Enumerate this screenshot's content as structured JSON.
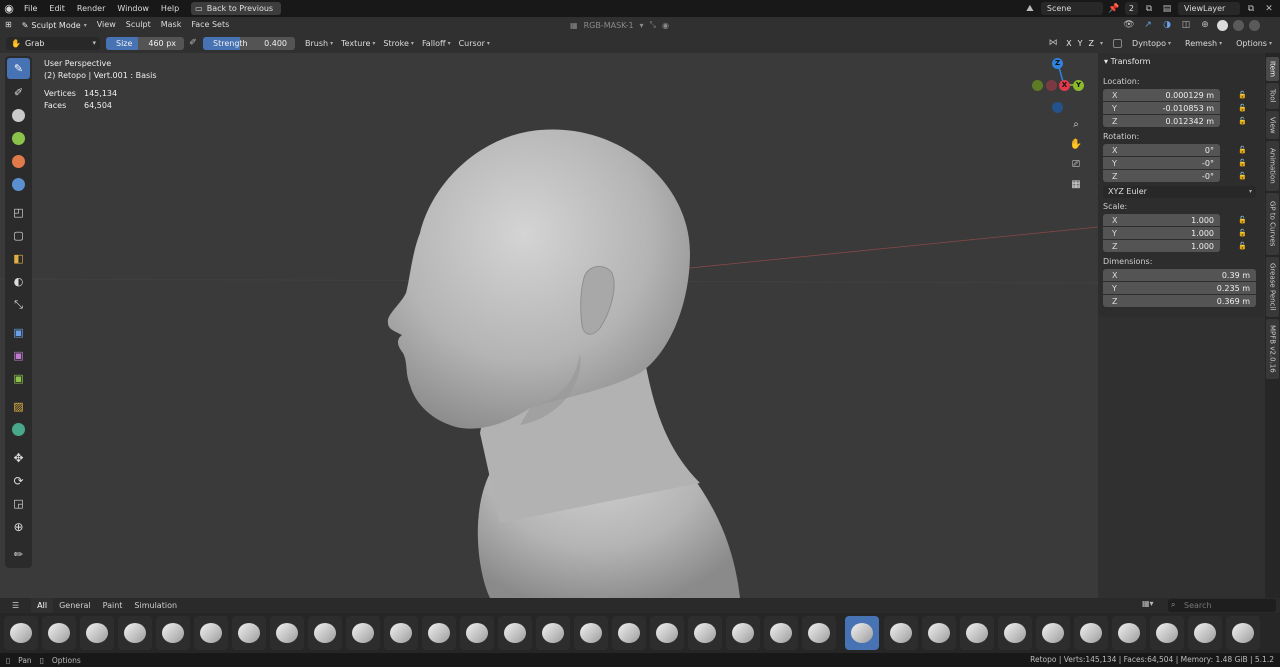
{
  "topbar": {
    "menus": [
      "File",
      "Edit",
      "Render",
      "Window",
      "Help"
    ],
    "back_button": "Back to Previous",
    "scene_label": "Scene",
    "scene_users": "2",
    "view_layer": "ViewLayer"
  },
  "header": {
    "mode": "Sculpt Mode",
    "menus": [
      "View",
      "Sculpt",
      "Mask",
      "Face Sets"
    ],
    "attribute": "RGB-MASK-1"
  },
  "toolsettings": {
    "brush": "Grab",
    "size_label": "Size",
    "size_value": "460 px",
    "strength_label": "Strength",
    "strength_value": "0.400",
    "strength_fraction": 0.4,
    "dropdowns": [
      "Brush",
      "Texture",
      "Stroke",
      "Falloff",
      "Cursor"
    ],
    "axes": [
      "X",
      "Y",
      "Z"
    ],
    "dyntopo": "Dyntopo",
    "remesh": "Remesh",
    "options": "Options"
  },
  "viewport": {
    "perspective": "User Perspective",
    "object": "(2) Retopo | Vert.001 : Basis",
    "stats": [
      {
        "label": "Vertices",
        "value": "145,134"
      },
      {
        "label": "Faces",
        "value": "64,504"
      }
    ],
    "gizmo": {
      "x": "X",
      "y": "Y",
      "z": "Z"
    }
  },
  "npanel": {
    "title": "Transform",
    "location_label": "Location:",
    "location": [
      {
        "axis": "X",
        "value": "0.000129 m"
      },
      {
        "axis": "Y",
        "value": "-0.010853 m"
      },
      {
        "axis": "Z",
        "value": "0.012342 m"
      }
    ],
    "rotation_label": "Rotation:",
    "rotation": [
      {
        "axis": "X",
        "value": "0°"
      },
      {
        "axis": "Y",
        "value": "-0°"
      },
      {
        "axis": "Z",
        "value": "-0°"
      }
    ],
    "rotation_mode": "XYZ Euler",
    "scale_label": "Scale:",
    "scale": [
      {
        "axis": "X",
        "value": "1.000"
      },
      {
        "axis": "Y",
        "value": "1.000"
      },
      {
        "axis": "Z",
        "value": "1.000"
      }
    ],
    "dimensions_label": "Dimensions:",
    "dimensions": [
      {
        "axis": "X",
        "value": "0.39 m"
      },
      {
        "axis": "Y",
        "value": "0.235 m"
      },
      {
        "axis": "Z",
        "value": "0.369 m"
      }
    ]
  },
  "tabs": [
    "Item",
    "Tool",
    "View",
    "Animation",
    "GP to Curves",
    "Grease Pencil",
    "MPFB v2.0.16"
  ],
  "shelf": {
    "tabs": [
      "All",
      "General",
      "Paint",
      "Simulation"
    ],
    "search_placeholder": "Search"
  },
  "status": {
    "left": [
      "Pan",
      "Options"
    ],
    "right": "Retopo | Verts:145,134 | Faces:64,504 | Memory: 1.48 GiB | 5.1.2"
  },
  "colors": {
    "accent": "#4772b3",
    "axis_x": "#e2394d",
    "axis_y": "#8cba2b",
    "axis_z": "#2f83e0"
  }
}
